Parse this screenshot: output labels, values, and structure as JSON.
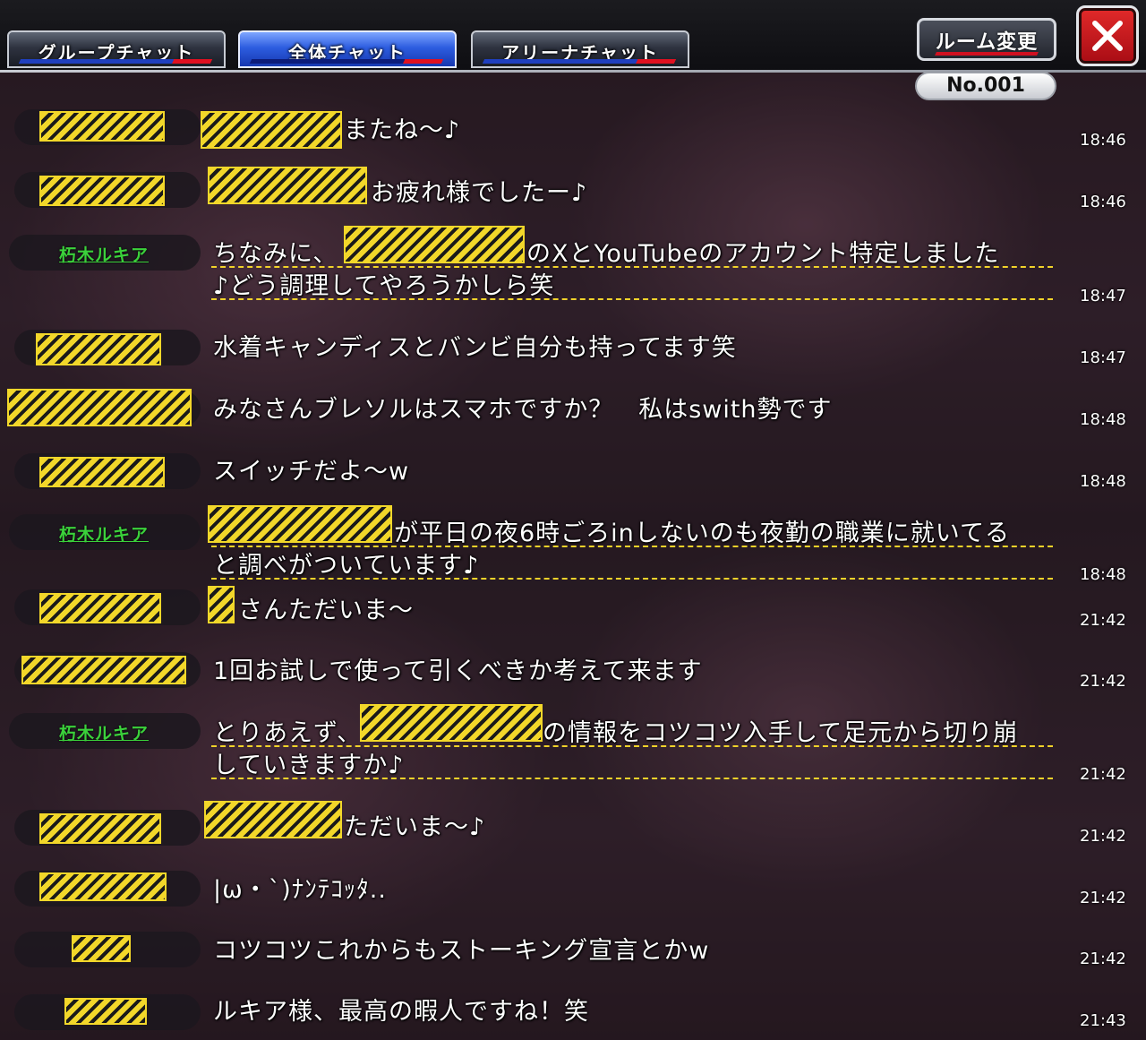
{
  "header": {
    "tabs": [
      {
        "label": "グループチャット"
      },
      {
        "label": "全体チャット"
      },
      {
        "label": "アリーナチャット"
      }
    ],
    "room_change_label": "ルーム変更",
    "room_number": "No.001",
    "close_icon": "close-icon"
  },
  "chat": {
    "rukia_name": "朽木ルキア",
    "messages": [
      {
        "text": "またね～♪",
        "time": "18:46"
      },
      {
        "text": "お疲れ様でしたー♪",
        "time": "18:46"
      },
      {
        "text": "のXとYouTubeのアカウント特定しました",
        "text2": "♪どう調理してやろうかしら笑",
        "prefix": "ちなみに、",
        "time": "18:47"
      },
      {
        "text": "水着キャンディスとバンビ自分も持ってます笑",
        "time": "18:47"
      },
      {
        "text": "みなさんブレソルはスマホですか？　私はswith勢です",
        "time": "18:48"
      },
      {
        "text": "スイッチだよ～w",
        "time": "18:48"
      },
      {
        "text": "が平日の夜6時ごろinしないのも夜勤の職業に就いてる",
        "text2": "と調べがついています♪",
        "time": "18:48"
      },
      {
        "text": "さんただいま～",
        "time": "21:42"
      },
      {
        "text": "1回お試しで使って引くべきか考えて来ます",
        "time": "21:42"
      },
      {
        "text": "の情報をコツコツ入手して足元から切り崩",
        "text2": "していきますか♪",
        "prefix": "とりあえず、",
        "time": "21:42"
      },
      {
        "text": "ただいま～♪",
        "time": "21:42"
      },
      {
        "text": "|ω・`)ﾅﾝﾃｺｯﾀ..",
        "time": "21:42"
      },
      {
        "text": "コツコツこれからもストーキング宣言とかw",
        "time": "21:42"
      },
      {
        "text": "ルキア様、最高の暇人ですね！笑",
        "time": "21:43"
      }
    ]
  },
  "colors": {
    "rukia_green": "#3bd13b",
    "redaction_yellow": "#f2d72a",
    "active_tab_blue": "#2d5de0",
    "close_red": "#d01a22"
  }
}
